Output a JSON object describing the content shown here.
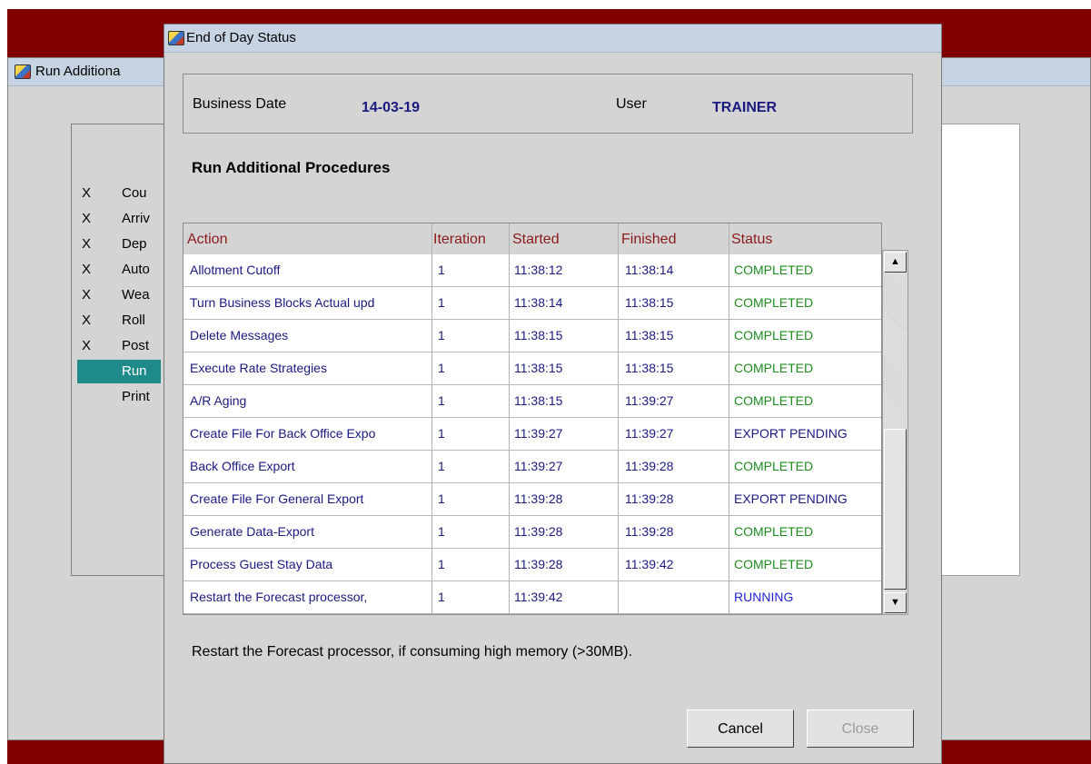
{
  "background_window": {
    "title": "Run Additiona",
    "procedures": [
      {
        "mark": "X",
        "label": "Cou"
      },
      {
        "mark": "X",
        "label": "Arriv"
      },
      {
        "mark": "X",
        "label": "Dep"
      },
      {
        "mark": "X",
        "label": "Auto"
      },
      {
        "mark": "X",
        "label": "Wea"
      },
      {
        "mark": "X",
        "label": "Roll"
      },
      {
        "mark": "X",
        "label": "Post"
      },
      {
        "mark": "",
        "label": "Run",
        "selected": true
      },
      {
        "mark": "",
        "label": "Print"
      }
    ]
  },
  "dialog": {
    "title": "End of Day Status",
    "business_date_label": "Business Date",
    "business_date_value": "14-03-19",
    "user_label": "User",
    "user_value": "TRAINER",
    "section_title": "Run Additional Procedures",
    "columns": [
      "Action",
      "Iteration",
      "Started",
      "Finished",
      "Status"
    ],
    "rows": [
      {
        "action": "Allotment Cutoff",
        "iteration": "1",
        "started": "11:38:12",
        "finished": "11:38:14",
        "status": "COMPLETED"
      },
      {
        "action": "Turn Business Blocks Actual upd",
        "iteration": "1",
        "started": "11:38:14",
        "finished": "11:38:15",
        "status": "COMPLETED"
      },
      {
        "action": "Delete Messages",
        "iteration": "1",
        "started": "11:38:15",
        "finished": "11:38:15",
        "status": "COMPLETED"
      },
      {
        "action": "Execute Rate Strategies",
        "iteration": "1",
        "started": "11:38:15",
        "finished": "11:38:15",
        "status": "COMPLETED"
      },
      {
        "action": "A/R Aging",
        "iteration": "1",
        "started": "11:38:15",
        "finished": "11:39:27",
        "status": "COMPLETED"
      },
      {
        "action": "Create File For Back Office Expo",
        "iteration": "1",
        "started": "11:39:27",
        "finished": "11:39:27",
        "status": "EXPORT PENDING"
      },
      {
        "action": "Back Office Export",
        "iteration": "1",
        "started": "11:39:27",
        "finished": "11:39:28",
        "status": "COMPLETED"
      },
      {
        "action": "Create File For General Export",
        "iteration": "1",
        "started": "11:39:28",
        "finished": "11:39:28",
        "status": "EXPORT PENDING"
      },
      {
        "action": "Generate Data-Export",
        "iteration": "1",
        "started": "11:39:28",
        "finished": "11:39:28",
        "status": "COMPLETED"
      },
      {
        "action": "Process Guest Stay Data",
        "iteration": "1",
        "started": "11:39:28",
        "finished": "11:39:42",
        "status": "COMPLETED"
      },
      {
        "action": "Restart the Forecast processor,",
        "iteration": "1",
        "started": "11:39:42",
        "finished": "",
        "status": "RUNNING"
      }
    ],
    "description": "Restart the Forecast processor, if consuming high memory (>30MB).",
    "cancel_label": "Cancel",
    "close_label": "Close"
  },
  "colors": {
    "completed": "#1f8a1f",
    "export_pending": "#1a1a80",
    "running": "#2323d6",
    "header_text": "#8b1a1a",
    "selection": "#1f8a8a",
    "frame": "#800000"
  }
}
